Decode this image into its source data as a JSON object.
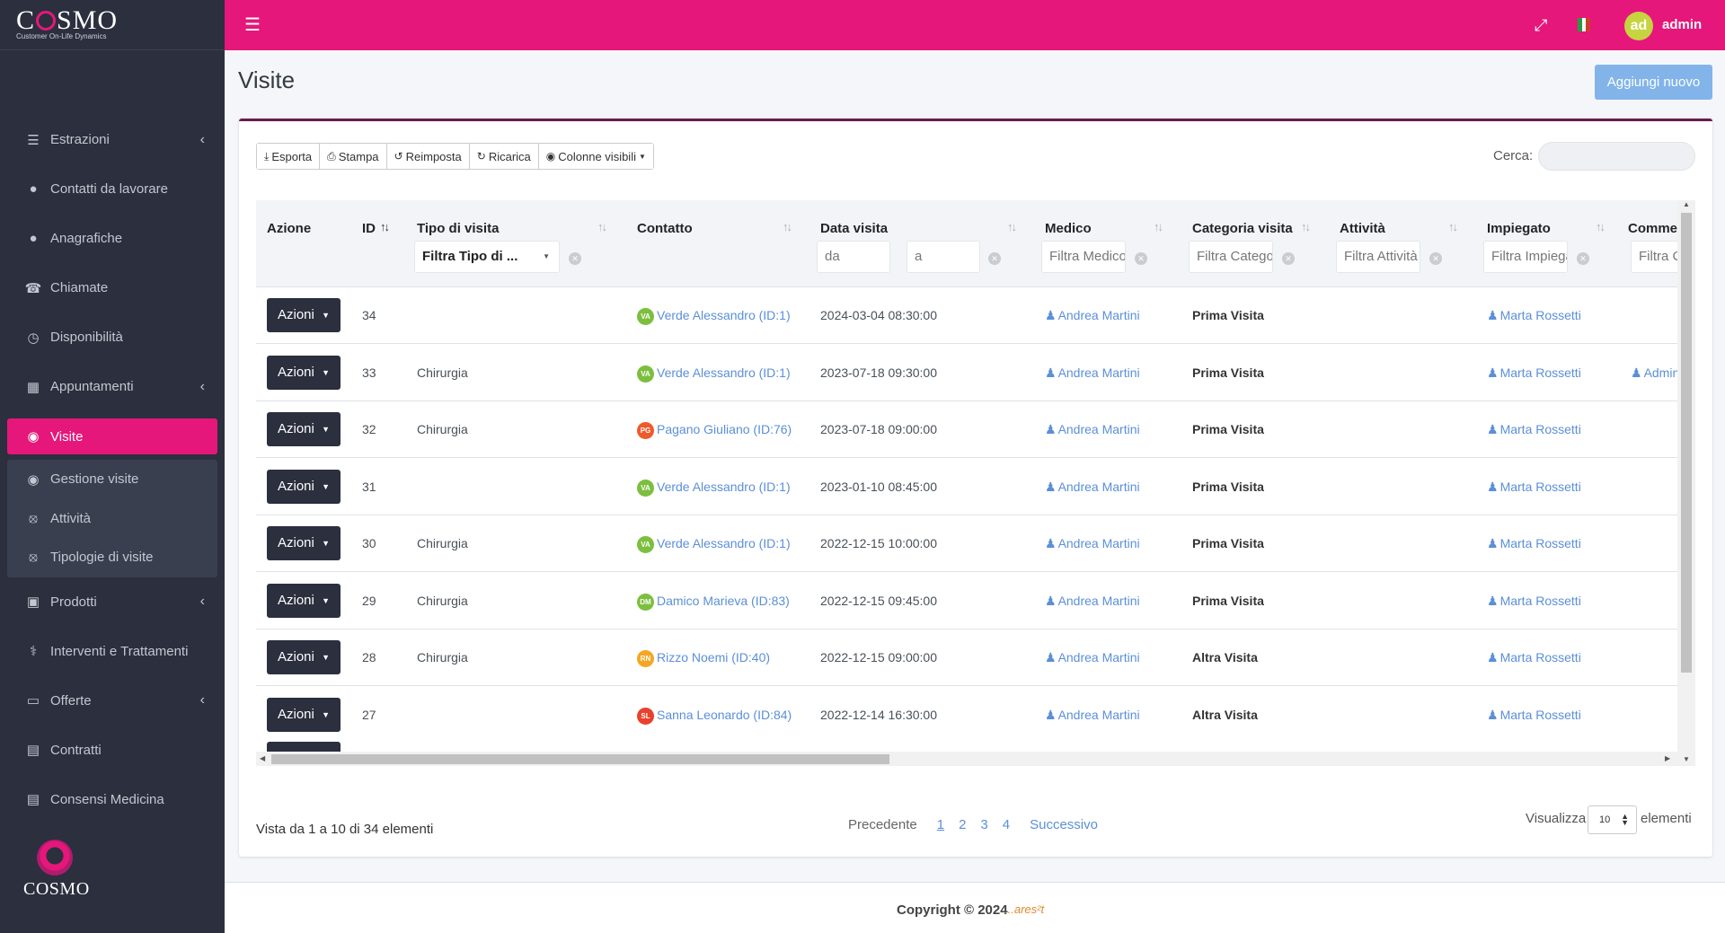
{
  "brand": {
    "title_pre": "C",
    "title_post": "SMO",
    "subtitle": "Customer On-Life Dynamics",
    "footer_logo": "COSMO"
  },
  "sidebar": {
    "items": [
      {
        "label": "Estrazioni",
        "icon": "sliders-icon",
        "chevron": true
      },
      {
        "label": "Contatti da lavorare",
        "icon": "user-icon",
        "chevron": false
      },
      {
        "label": "Anagrafiche",
        "icon": "user-icon",
        "chevron": false
      },
      {
        "label": "Chiamate",
        "icon": "phone-icon",
        "chevron": false
      },
      {
        "label": "Disponibilità",
        "icon": "clock-icon",
        "chevron": false
      },
      {
        "label": "Appuntamenti",
        "icon": "calendar-icon",
        "chevron": true
      },
      {
        "label": "Visite",
        "icon": "eye-icon",
        "chevron": false,
        "active": true
      },
      {
        "label": "Gestione visite",
        "icon": "eye-icon",
        "sub": true
      },
      {
        "label": "Attività",
        "icon": "eye-slash-icon",
        "sub": true
      },
      {
        "label": "Tipologie di visite",
        "icon": "eye-slash-icon",
        "sub": true
      },
      {
        "label": "Prodotti",
        "icon": "box-icon",
        "chevron": true
      },
      {
        "label": "Interventi e Trattamenti",
        "icon": "stethoscope-icon",
        "chevron": false
      },
      {
        "label": "Offerte",
        "icon": "card-icon",
        "chevron": true
      },
      {
        "label": "Contratti",
        "icon": "money-icon",
        "chevron": false
      },
      {
        "label": "Consensi Medicina",
        "icon": "money-icon",
        "chevron": false
      }
    ]
  },
  "header": {
    "user_initials": "ad",
    "user_name": "admin",
    "accent": "#e6177a"
  },
  "page": {
    "title": "Visite",
    "add_button": "Aggiungi nuovo"
  },
  "toolbar": {
    "export": "Esporta",
    "print": "Stampa",
    "reset": "Reimposta",
    "reload": "Ricarica",
    "columns": "Colonne visibili"
  },
  "search": {
    "label": "Cerca:"
  },
  "table": {
    "headers": {
      "azione": "Azione",
      "id": "ID",
      "tipo": "Tipo di visita",
      "contatto": "Contatto",
      "data": "Data visita",
      "medico": "Medico",
      "categoria": "Categoria visita",
      "attivita": "Attività",
      "impiegato": "Impiegato",
      "commento": "Comme"
    },
    "filters": {
      "tipo": "Filtra Tipo di ...",
      "da": "da",
      "a": "a",
      "medico": "Filtra Medico",
      "categoria": "Filtra Categoria",
      "attivita": "Filtra Attività",
      "impiegato": "Filtra Impiegato",
      "commento": "Filtra C"
    },
    "action_label": "Azioni",
    "rows": [
      {
        "id": "34",
        "tipo": "",
        "initials": "VA",
        "badge": "#7cbf3f",
        "contatto": "Verde Alessandro (ID:1)",
        "data": "2024-03-04 08:30:00",
        "medico": "Andrea Martini",
        "categoria": "Prima Visita",
        "impiegato": "Marta Rossetti",
        "commento": ""
      },
      {
        "id": "33",
        "tipo": "Chirurgia",
        "initials": "VA",
        "badge": "#7cbf3f",
        "contatto": "Verde Alessandro (ID:1)",
        "data": "2023-07-18 09:30:00",
        "medico": "Andrea Martini",
        "categoria": "Prima Visita",
        "impiegato": "Marta Rossetti",
        "commento": "Admin"
      },
      {
        "id": "32",
        "tipo": "Chirurgia",
        "initials": "PG",
        "badge": "#ee5a2b",
        "contatto": "Pagano Giuliano (ID:76)",
        "data": "2023-07-18 09:00:00",
        "medico": "Andrea Martini",
        "categoria": "Prima Visita",
        "impiegato": "Marta Rossetti",
        "commento": ""
      },
      {
        "id": "31",
        "tipo": "",
        "initials": "VA",
        "badge": "#7cbf3f",
        "contatto": "Verde Alessandro (ID:1)",
        "data": "2023-01-10 08:45:00",
        "medico": "Andrea Martini",
        "categoria": "Prima Visita",
        "impiegato": "Marta Rossetti",
        "commento": ""
      },
      {
        "id": "30",
        "tipo": "Chirurgia",
        "initials": "VA",
        "badge": "#7cbf3f",
        "contatto": "Verde Alessandro (ID:1)",
        "data": "2022-12-15 10:00:00",
        "medico": "Andrea Martini",
        "categoria": "Prima Visita",
        "impiegato": "Marta Rossetti",
        "commento": ""
      },
      {
        "id": "29",
        "tipo": "Chirurgia",
        "initials": "DM",
        "badge": "#7cbf3f",
        "contatto": "Damico Marieva (ID:83)",
        "data": "2022-12-15 09:45:00",
        "medico": "Andrea Martini",
        "categoria": "Prima Visita",
        "impiegato": "Marta Rossetti",
        "commento": ""
      },
      {
        "id": "28",
        "tipo": "Chirurgia",
        "initials": "RN",
        "badge": "#f5a623",
        "contatto": "Rizzo Noemi (ID:40)",
        "data": "2022-12-15 09:00:00",
        "medico": "Andrea Martini",
        "categoria": "Altra Visita",
        "impiegato": "Marta Rossetti",
        "commento": ""
      },
      {
        "id": "27",
        "tipo": "",
        "initials": "SL",
        "badge": "#e8412d",
        "contatto": "Sanna Leonardo (ID:84)",
        "data": "2022-12-14 16:30:00",
        "medico": "Andrea Martini",
        "categoria": "Altra Visita",
        "impiegato": "Marta Rossetti",
        "commento": ""
      }
    ]
  },
  "footer_info": {
    "summary": "Vista da 1 a 10 di 34 elementi"
  },
  "pagination": {
    "prev": "Precedente",
    "pages": [
      "1",
      "2",
      "3",
      "4"
    ],
    "current": "1",
    "next": "Successivo"
  },
  "length": {
    "label": "Visualizza",
    "value": "10",
    "suffix": "elementi"
  },
  "footer": {
    "copyright": "Copyright © 2024",
    "logo": "...ares²t"
  }
}
